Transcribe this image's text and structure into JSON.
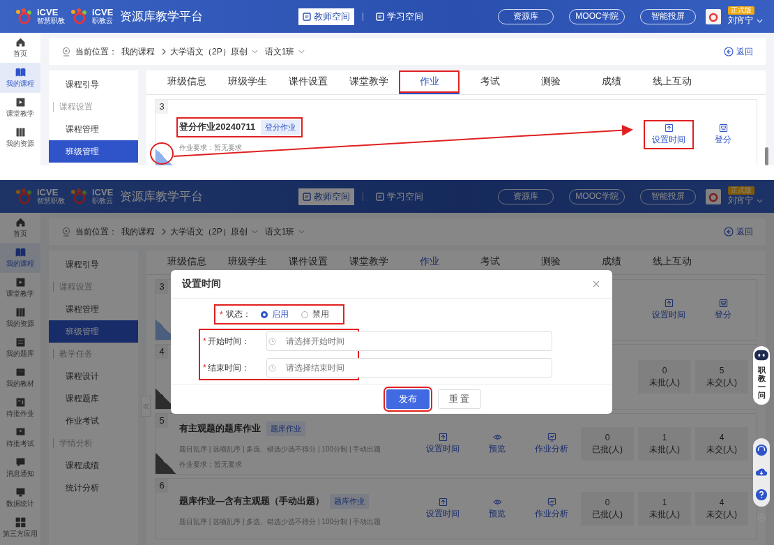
{
  "screens": [
    {
      "header": {
        "brands": [
          {
            "mark": "iCVE",
            "sub": "智慧职教"
          },
          {
            "mark": "iCVE",
            "sub": "职教云"
          }
        ],
        "title": "资源库教学平台",
        "spaces": [
          {
            "label": "教师空间",
            "selected": true
          },
          {
            "label": "学习空间",
            "selected": false
          }
        ],
        "links": [
          "资源库",
          "MOOC学院",
          "智能投屏"
        ],
        "badge": "正式版",
        "user": "刘宵宁"
      },
      "rail": [
        {
          "label": "首页",
          "selected": false
        },
        {
          "label": "我的课程",
          "selected": true
        },
        {
          "label": "课堂教学",
          "selected": false
        },
        {
          "label": "我的资源",
          "selected": false
        }
      ],
      "breadcrumb": {
        "label": "当前位置：",
        "items": [
          {
            "text": "我的课程",
            "dropdown": false
          },
          {
            "text": "大学语文（2P）原创",
            "dropdown": true
          },
          {
            "text": "语文1班",
            "dropdown": true
          }
        ],
        "back": "返回"
      },
      "sidebar": [
        {
          "label": "课程引导",
          "kind": "item",
          "selected": false
        },
        {
          "label": "课程设置",
          "kind": "section"
        },
        {
          "label": "课程管理",
          "kind": "item",
          "selected": false
        },
        {
          "label": "班级管理",
          "kind": "item",
          "selected": true
        }
      ],
      "tabs": [
        {
          "label": "班级信息",
          "selected": false,
          "annotated": false
        },
        {
          "label": "班级学生",
          "selected": false,
          "annotated": false
        },
        {
          "label": "课件设置",
          "selected": false,
          "annotated": false
        },
        {
          "label": "课堂教学",
          "selected": false,
          "annotated": false
        },
        {
          "label": "作业",
          "selected": true,
          "annotated": true
        },
        {
          "label": "考试",
          "selected": false,
          "annotated": false
        },
        {
          "label": "测验",
          "selected": false,
          "annotated": false
        },
        {
          "label": "成绩",
          "selected": false,
          "annotated": false
        },
        {
          "label": "线上互动",
          "selected": false,
          "annotated": false
        }
      ],
      "cards": [
        {
          "number": "3",
          "title": "登分作业20240711",
          "tag": "登分作业",
          "heading_annotated": true,
          "requirement": "作业要求：暂无要求",
          "disabled": false,
          "actions": [
            {
              "label": "设置时间",
              "kind": "time",
              "annotated": true
            },
            {
              "label": "登分",
              "kind": "score",
              "annotated": false
            }
          ]
        }
      ],
      "callout": true,
      "scrollbar": true
    },
    {
      "header": {
        "brands": [
          {
            "mark": "iCVE",
            "sub": "智慧职教"
          },
          {
            "mark": "iCVE",
            "sub": "职教云"
          }
        ],
        "title": "资源库教学平台",
        "spaces": [
          {
            "label": "教师空间",
            "selected": true
          },
          {
            "label": "学习空间",
            "selected": false
          }
        ],
        "links": [
          "资源库",
          "MOOC学院",
          "智能投屏"
        ],
        "badge": "正式版",
        "user": "刘宵宁"
      },
      "rail": [
        {
          "label": "首页",
          "selected": false
        },
        {
          "label": "我的课程",
          "selected": true
        },
        {
          "label": "课堂教学",
          "selected": false
        },
        {
          "label": "我的资源",
          "selected": false
        },
        {
          "label": "我的题库",
          "selected": false
        },
        {
          "label": "我的教材",
          "selected": false
        },
        {
          "label": "待批作业",
          "selected": false
        },
        {
          "label": "待批考试",
          "selected": false
        },
        {
          "label": "消息通知",
          "selected": false
        },
        {
          "label": "数据统计",
          "selected": false
        },
        {
          "label": "第三方应用",
          "selected": false
        }
      ],
      "breadcrumb": {
        "label": "当前位置：",
        "items": [
          {
            "text": "我的课程",
            "dropdown": false
          },
          {
            "text": "大学语文（2P）原创",
            "dropdown": true
          },
          {
            "text": "语文1班",
            "dropdown": true
          }
        ],
        "back": "返回"
      },
      "sidebar": [
        {
          "label": "课程引导",
          "kind": "item",
          "selected": false
        },
        {
          "label": "课程设置",
          "kind": "section"
        },
        {
          "label": "课程管理",
          "kind": "item",
          "selected": false
        },
        {
          "label": "班级管理",
          "kind": "item",
          "selected": true
        },
        {
          "label": "教学任务",
          "kind": "section"
        },
        {
          "label": "课程设计",
          "kind": "item",
          "selected": false
        },
        {
          "label": "课程题库",
          "kind": "item",
          "selected": false
        },
        {
          "label": "作业考试",
          "kind": "item",
          "selected": false
        },
        {
          "label": "学情分析",
          "kind": "section"
        },
        {
          "label": "课程成绩",
          "kind": "item",
          "selected": false
        },
        {
          "label": "统计分析",
          "kind": "item",
          "selected": false
        }
      ],
      "tabs": [
        {
          "label": "班级信息",
          "selected": false
        },
        {
          "label": "班级学生",
          "selected": false
        },
        {
          "label": "课件设置",
          "selected": false
        },
        {
          "label": "课堂教学",
          "selected": false
        },
        {
          "label": "作业",
          "selected": true
        },
        {
          "label": "考试",
          "selected": false
        },
        {
          "label": "测验",
          "selected": false
        },
        {
          "label": "成绩",
          "selected": false
        },
        {
          "label": "线上互动",
          "selected": false
        }
      ],
      "cards": [
        {
          "number": "3",
          "disabled": false,
          "actions": [
            {
              "label": "设置时间",
              "kind": "time"
            },
            {
              "label": "登分",
              "kind": "score"
            }
          ]
        },
        {
          "number": "4",
          "disabled": true,
          "stats": [
            {
              "value": "0",
              "label": "未批(人)"
            },
            {
              "value": "5",
              "label": "未交(人)"
            }
          ]
        },
        {
          "number": "5",
          "title": "有主观题的题库作业",
          "tag": "题库作业",
          "meta": "题目乱序 | 选项乱序 | 多选、错选少选不得分 | 100分制 | 手动出题",
          "requirement": "作业要求：暂无要求",
          "disabled": true,
          "actions": [
            {
              "label": "设置时间",
              "kind": "time"
            },
            {
              "label": "预览",
              "kind": "preview"
            },
            {
              "label": "作业分析",
              "kind": "analysis"
            }
          ],
          "stats": [
            {
              "value": "0",
              "label": "已批(人)"
            },
            {
              "value": "1",
              "label": "未批(人)"
            },
            {
              "value": "4",
              "label": "未交(人)"
            }
          ]
        },
        {
          "number": "6",
          "title": "题库作业—含有主观题（手动出题）",
          "tag": "题库作业",
          "meta": "题目乱序 | 选项乱序 | 多选、错选少选不得分 | 100分制 | 手动出题",
          "actions": [
            {
              "label": "设置时间",
              "kind": "time"
            },
            {
              "label": "预览",
              "kind": "preview"
            },
            {
              "label": "作业分析",
              "kind": "analysis"
            }
          ],
          "stats": [
            {
              "value": "0",
              "label": "已批(人)"
            },
            {
              "value": "1",
              "label": "未批(人)"
            },
            {
              "value": "4",
              "label": "未交(人)"
            }
          ]
        }
      ],
      "dialog": {
        "title": "设置时间",
        "status": {
          "mark": "*",
          "label": "状态：",
          "annotated": true,
          "options": [
            {
              "label": "启用",
              "selected": true
            },
            {
              "label": "禁用",
              "selected": false
            }
          ]
        },
        "times": {
          "annotated": true,
          "fields": [
            {
              "mark": "*",
              "label": "开始时间：",
              "placeholder": "请选择开始时间"
            },
            {
              "mark": "*",
              "label": "结束时间：",
              "placeholder": "请选择结束时间"
            }
          ]
        },
        "buttons": [
          {
            "label": "发布",
            "kind": "primary",
            "annotated": true
          },
          {
            "label": "重 置",
            "kind": "default",
            "annotated": false
          }
        ]
      },
      "assistant": {
        "label": "职教一问"
      },
      "tools": true
    }
  ]
}
